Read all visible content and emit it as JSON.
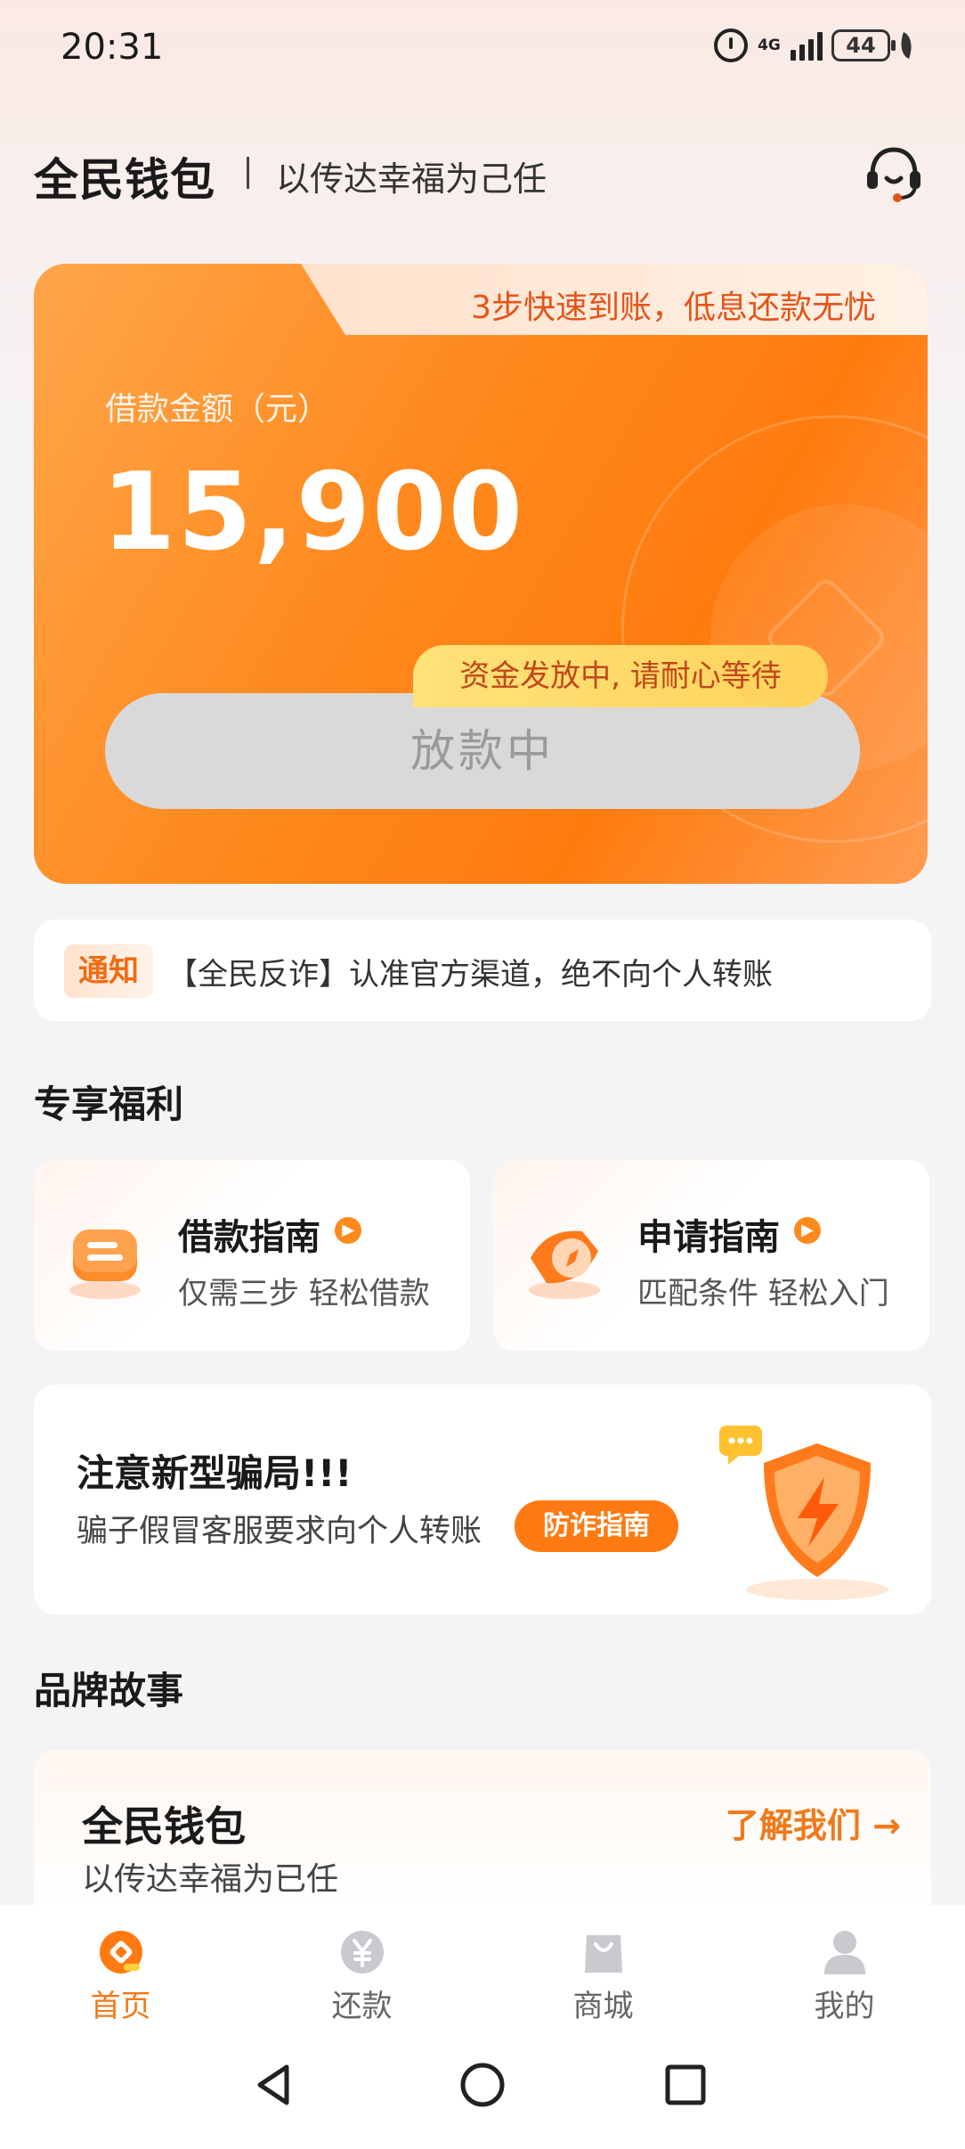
{
  "status_bar": {
    "time": "20:31",
    "network": "4G",
    "battery": "44"
  },
  "header": {
    "title": "全民钱包",
    "slogan": "以传达幸福为己任",
    "service_icon": "headset-icon"
  },
  "loan_card": {
    "banner": "3步快速到账，低息还款无忧",
    "amount_label": "借款金额（元）",
    "amount_value": "15,900",
    "tooltip": "资金发放中, 请耐心等待",
    "button_label": "放款中"
  },
  "notice": {
    "tag": "通知",
    "text": "【全民反诈】认准官方渠道，绝不向个人转账"
  },
  "benefits": {
    "title": "专享福利",
    "cards": [
      {
        "title": "借款指南",
        "subtitle": "仅需三步 轻松借款",
        "icon": "loan-guide-icon"
      },
      {
        "title": "申请指南",
        "subtitle": "匹配条件 轻松入门",
        "icon": "compass-icon"
      }
    ]
  },
  "fraud": {
    "title": "注意新型骗局!!!",
    "subtitle": "骗子假冒客服要求向个人转账",
    "button_label": "防诈指南"
  },
  "brand": {
    "section_title": "品牌故事",
    "title": "全民钱包",
    "subtitle": "以传达幸福为已任",
    "link": "了解我们 →"
  },
  "tabs": [
    {
      "label": "首页",
      "icon": "home-icon",
      "active": true
    },
    {
      "label": "还款",
      "icon": "yen-icon",
      "active": false
    },
    {
      "label": "商城",
      "icon": "shopping-bag-icon",
      "active": false
    },
    {
      "label": "我的",
      "icon": "user-icon",
      "active": false
    }
  ],
  "colors": {
    "accent": "#ff7a12",
    "accent_text": "#f07a1a",
    "background": "#f4f4f6"
  }
}
